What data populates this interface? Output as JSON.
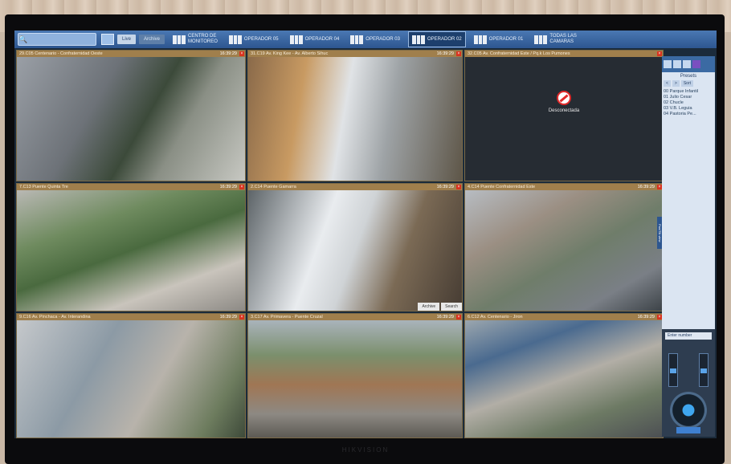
{
  "toolbar": {
    "btn_a": "Live",
    "btn_b": "Archive",
    "tabs": [
      {
        "line1": "CENTRO DE",
        "line2": "MONITOREO"
      },
      {
        "line1": "OPERADOR 05",
        "line2": ""
      },
      {
        "line1": "OPERADOR 04",
        "line2": ""
      },
      {
        "line1": "OPERADOR 03",
        "line2": ""
      },
      {
        "line1": "OPERADOR 02",
        "line2": ""
      },
      {
        "line1": "OPERADOR 01",
        "line2": ""
      },
      {
        "line1": "TODAS LAS",
        "line2": "CAMARAS"
      }
    ]
  },
  "cameras": [
    {
      "title": "29.C05 Centenario - Confraternidad Oeste",
      "time": "16:39:29"
    },
    {
      "title": "31.C19 Av. King Kee - Av. Alberto Sihuc",
      "time": "16:39:29"
    },
    {
      "title": "32.C05 Av. Confraternidad Este / Pq.k Los Pumones",
      "time": "16:39:29",
      "status": "Desconectada"
    },
    {
      "title": "7.C13 Puente Quinta Tre",
      "time": "16:39:29"
    },
    {
      "title": "2.C14 Puente Gamarra",
      "time": "16:39:29",
      "controls": [
        "Archive",
        "Search"
      ]
    },
    {
      "title": "4.C14 Puente Confraternidad Este",
      "time": "16:39:29"
    },
    {
      "title": "9.C16 Av. Pinchaca - Av. Interandina",
      "time": "16:39:29"
    },
    {
      "title": "3.C17 Av. Primavera - Puente Cruzal",
      "time": "16:39:29"
    },
    {
      "title": "6.C12 Av. Centenario - Jiron",
      "time": "16:39:29"
    }
  ],
  "panel": {
    "title": "Presets",
    "nav": [
      "<",
      ">",
      "Sort"
    ],
    "presets": [
      "00  Parque Infantil",
      "01  Julio Cesar",
      "02  Chucle",
      "03  V.B. Leguia",
      "04  Pastoria Pe..."
    ],
    "enter_label": "Enter number",
    "vtab_label": "Pan/Tilt view"
  },
  "brand": "HIKVISION"
}
